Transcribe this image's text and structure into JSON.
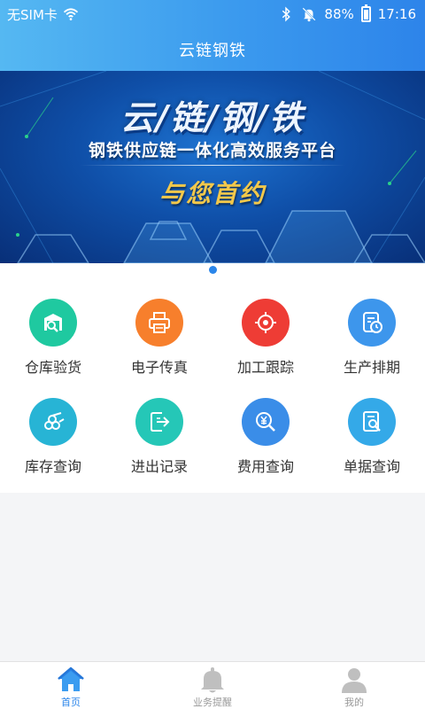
{
  "status_bar": {
    "carrier": "无SIM卡",
    "battery": "88%",
    "time": "17:16"
  },
  "app": {
    "title": "云链钢铁"
  },
  "banner": {
    "title": "云/链/钢/铁",
    "subtitle": "钢铁供应链一体化高效服务平台",
    "slogan": "与您首约"
  },
  "menu": [
    {
      "label": "仓库验货",
      "icon": "warehouse-inspect-icon",
      "color": "#1fc9a0"
    },
    {
      "label": "电子传真",
      "icon": "printer-icon",
      "color": "#f77f2c"
    },
    {
      "label": "加工跟踪",
      "icon": "target-icon",
      "color": "#ee3c35"
    },
    {
      "label": "生产排期",
      "icon": "schedule-clock-icon",
      "color": "#3d96ec"
    },
    {
      "label": "库存查询",
      "icon": "steel-pipes-icon",
      "color": "#27b4d5"
    },
    {
      "label": "进出记录",
      "icon": "in-out-record-icon",
      "color": "#25c7b7"
    },
    {
      "label": "费用查询",
      "icon": "yuan-search-icon",
      "color": "#3a8de8"
    },
    {
      "label": "单据查询",
      "icon": "document-search-icon",
      "color": "#34a9e8"
    }
  ],
  "tabs": [
    {
      "label": "首页",
      "icon": "home-icon"
    },
    {
      "label": "业务提醒",
      "icon": "bell-icon"
    },
    {
      "label": "我的",
      "icon": "user-icon"
    }
  ],
  "colors": {
    "header_start": "#55b8f2",
    "header_end": "#2d84ea",
    "active_tab": "#2b86ea",
    "inactive_tab": "#bfbfbf"
  }
}
